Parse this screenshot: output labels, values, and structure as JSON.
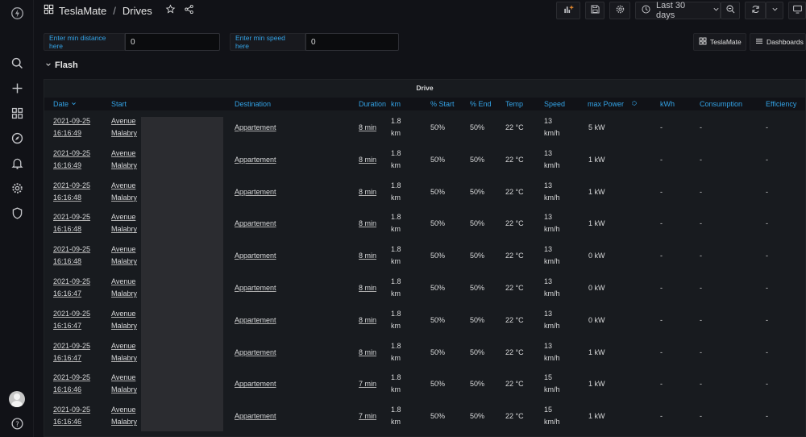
{
  "breadcrumb": {
    "folder": "TeslaMate",
    "separator": "/",
    "dashboard": "Drives"
  },
  "toolbar": {
    "time_range": "Last 30 days"
  },
  "variables": [
    {
      "label": "Enter min distance here",
      "value": "0"
    },
    {
      "label": "Enter min speed here",
      "value": "0"
    }
  ],
  "dash_links": {
    "teslamate": "TeslaMate",
    "dashboards": "Dashboards"
  },
  "row": {
    "title": "Flash"
  },
  "panel": {
    "title": "Drive",
    "columns": [
      "Date",
      "Start",
      "Destination",
      "Duration",
      "km",
      "% Start",
      "% End",
      "Temp",
      "Speed",
      "max Power",
      "kWh",
      "Consumption",
      "Efficiency"
    ],
    "rows": [
      {
        "date": "2021-09-25",
        "time": "16:16:49",
        "start1": "Avenue",
        "start2": "Malabry",
        "dest": "Appartement",
        "dur": "8 min",
        "km1": "1.8",
        "km2": "km",
        "ps": "50%",
        "pe": "50%",
        "temp": "22 °C",
        "sp1": "13",
        "sp2": "km/h",
        "pow": "5 kW",
        "kwh": "-",
        "cons": "-",
        "eff": "-"
      },
      {
        "date": "2021-09-25",
        "time": "16:16:49",
        "start1": "Avenue",
        "start2": "Malabry",
        "dest": "Appartement",
        "dur": "8 min",
        "km1": "1.8",
        "km2": "km",
        "ps": "50%",
        "pe": "50%",
        "temp": "22 °C",
        "sp1": "13",
        "sp2": "km/h",
        "pow": "1 kW",
        "kwh": "-",
        "cons": "-",
        "eff": "-"
      },
      {
        "date": "2021-09-25",
        "time": "16:16:48",
        "start1": "Avenue",
        "start2": "Malabry",
        "dest": "Appartement",
        "dur": "8 min",
        "km1": "1.8",
        "km2": "km",
        "ps": "50%",
        "pe": "50%",
        "temp": "22 °C",
        "sp1": "13",
        "sp2": "km/h",
        "pow": "1 kW",
        "kwh": "-",
        "cons": "-",
        "eff": "-"
      },
      {
        "date": "2021-09-25",
        "time": "16:16:48",
        "start1": "Avenue",
        "start2": "Malabry",
        "dest": "Appartement",
        "dur": "8 min",
        "km1": "1.8",
        "km2": "km",
        "ps": "50%",
        "pe": "50%",
        "temp": "22 °C",
        "sp1": "13",
        "sp2": "km/h",
        "pow": "1 kW",
        "kwh": "-",
        "cons": "-",
        "eff": "-"
      },
      {
        "date": "2021-09-25",
        "time": "16:16:48",
        "start1": "Avenue",
        "start2": "Malabry",
        "dest": "Appartement",
        "dur": "8 min",
        "km1": "1.8",
        "km2": "km",
        "ps": "50%",
        "pe": "50%",
        "temp": "22 °C",
        "sp1": "13",
        "sp2": "km/h",
        "pow": "0 kW",
        "kwh": "-",
        "cons": "-",
        "eff": "-"
      },
      {
        "date": "2021-09-25",
        "time": "16:16:47",
        "start1": "Avenue",
        "start2": "Malabry",
        "dest": "Appartement",
        "dur": "8 min",
        "km1": "1.8",
        "km2": "km",
        "ps": "50%",
        "pe": "50%",
        "temp": "22 °C",
        "sp1": "13",
        "sp2": "km/h",
        "pow": "0 kW",
        "kwh": "-",
        "cons": "-",
        "eff": "-"
      },
      {
        "date": "2021-09-25",
        "time": "16:16:47",
        "start1": "Avenue",
        "start2": "Malabry",
        "dest": "Appartement",
        "dur": "8 min",
        "km1": "1.8",
        "km2": "km",
        "ps": "50%",
        "pe": "50%",
        "temp": "22 °C",
        "sp1": "13",
        "sp2": "km/h",
        "pow": "0 kW",
        "kwh": "-",
        "cons": "-",
        "eff": "-"
      },
      {
        "date": "2021-09-25",
        "time": "16:16:47",
        "start1": "Avenue",
        "start2": "Malabry",
        "dest": "Appartement",
        "dur": "8 min",
        "km1": "1.8",
        "km2": "km",
        "ps": "50%",
        "pe": "50%",
        "temp": "22 °C",
        "sp1": "13",
        "sp2": "km/h",
        "pow": "1 kW",
        "kwh": "-",
        "cons": "-",
        "eff": "-"
      },
      {
        "date": "2021-09-25",
        "time": "16:16:46",
        "start1": "Avenue",
        "start2": "Malabry",
        "dest": "Appartement",
        "dur": "7 min",
        "km1": "1.8",
        "km2": "km",
        "ps": "50%",
        "pe": "50%",
        "temp": "22 °C",
        "sp1": "15",
        "sp2": "km/h",
        "pow": "1 kW",
        "kwh": "-",
        "cons": "-",
        "eff": "-"
      },
      {
        "date": "2021-09-25",
        "time": "16:16:46",
        "start1": "Avenue",
        "start2": "Malabry",
        "dest": "Appartement",
        "dur": "7 min",
        "km1": "1.8",
        "km2": "km",
        "ps": "50%",
        "pe": "50%",
        "temp": "22 °C",
        "sp1": "15",
        "sp2": "km/h",
        "pow": "1 kW",
        "kwh": "-",
        "cons": "-",
        "eff": "-"
      }
    ]
  },
  "colors": {
    "accent": "#33a2e5",
    "background": "#111217",
    "panel": "#181b1f"
  },
  "icons": {
    "sidebar": [
      "grafana-logo-icon",
      "search-icon",
      "plus-icon",
      "dashboards-icon",
      "explore-icon",
      "bell-icon",
      "gear-icon",
      "shield-icon",
      "help-icon"
    ]
  }
}
